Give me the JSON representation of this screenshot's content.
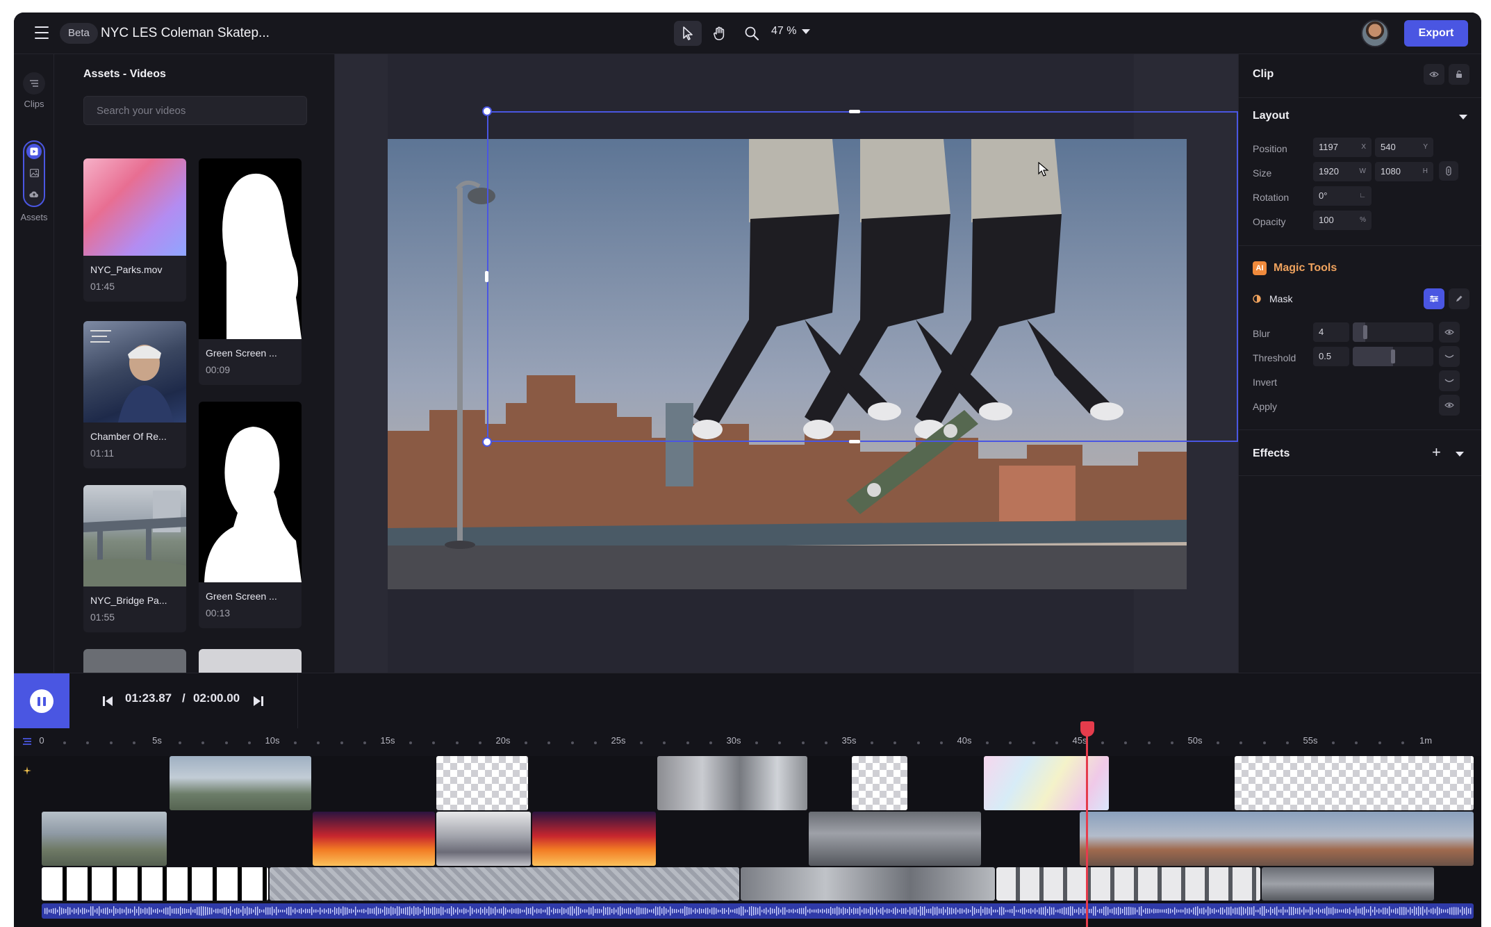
{
  "header": {
    "beta_label": "Beta",
    "project_title": "NYC LES Coleman Skatep...",
    "zoom_level": "47 %",
    "export_label": "Export"
  },
  "rail": {
    "clips_label": "Clips",
    "assets_label": "Assets"
  },
  "assets": {
    "title": "Assets - Videos",
    "search_placeholder": "Search your videos",
    "items": [
      {
        "name": "NYC_Parks.mov",
        "duration": "01:45"
      },
      {
        "name": "Green Screen ...",
        "duration": "00:09"
      },
      {
        "name": "Chamber Of Re...",
        "duration": "01:11"
      },
      {
        "name": "Green Screen ...",
        "duration": "00:13"
      },
      {
        "name": "NYC_Bridge Pa...",
        "duration": "01:55"
      }
    ]
  },
  "props": {
    "clip_title": "Clip",
    "layout": {
      "title": "Layout",
      "position_label": "Position",
      "position_x": "1197",
      "position_x_unit": "X",
      "position_y": "540",
      "position_y_unit": "Y",
      "size_label": "Size",
      "size_w": "1920",
      "size_w_unit": "W",
      "size_h": "1080",
      "size_h_unit": "H",
      "rotation_label": "Rotation",
      "rotation_value": "0°",
      "opacity_label": "Opacity",
      "opacity_value": "100",
      "opacity_unit": "%"
    },
    "magic": {
      "ai_badge": "AI",
      "title": "Magic Tools",
      "mask_label": "Mask",
      "blur_label": "Blur",
      "blur_value": "4",
      "threshold_label": "Threshold",
      "threshold_value": "0.5",
      "invert_label": "Invert",
      "apply_label": "Apply"
    },
    "effects_title": "Effects"
  },
  "transport": {
    "current_time": "01:23.87",
    "separator": "/",
    "total_time": "02:00.00"
  },
  "timeline": {
    "ticks": [
      "0",
      "5s",
      "10s",
      "15s",
      "20s",
      "25s",
      "30s",
      "35s",
      "40s",
      "45s",
      "50s",
      "55s",
      "1m"
    ]
  }
}
